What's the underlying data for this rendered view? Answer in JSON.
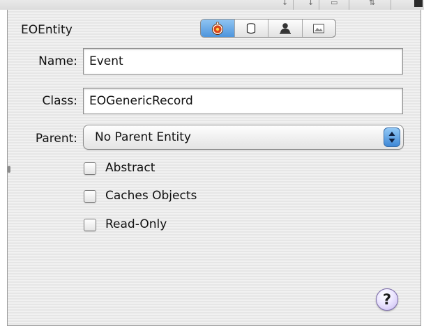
{
  "panel": {
    "title": "EOEntity",
    "inspector_tabs": [
      {
        "icon": "attributes-icon",
        "active": true
      },
      {
        "icon": "stored-procedure-icon",
        "active": false
      },
      {
        "icon": "user-info-icon",
        "active": false
      },
      {
        "icon": "image-icon",
        "active": false
      }
    ]
  },
  "form": {
    "name_label": "Name:",
    "name_value": "Event",
    "class_label": "Class:",
    "class_value": "EOGenericRecord",
    "parent_label": "Parent:",
    "parent_value": "No Parent Entity"
  },
  "options": {
    "abstract_label": "Abstract",
    "abstract_checked": false,
    "caches_label": "Caches Objects",
    "caches_checked": false,
    "readonly_label": "Read-Only",
    "readonly_checked": false
  },
  "help": {
    "glyph": "?"
  },
  "colors": {
    "accent": "#4e95dc",
    "help": "#c7b8ef"
  }
}
